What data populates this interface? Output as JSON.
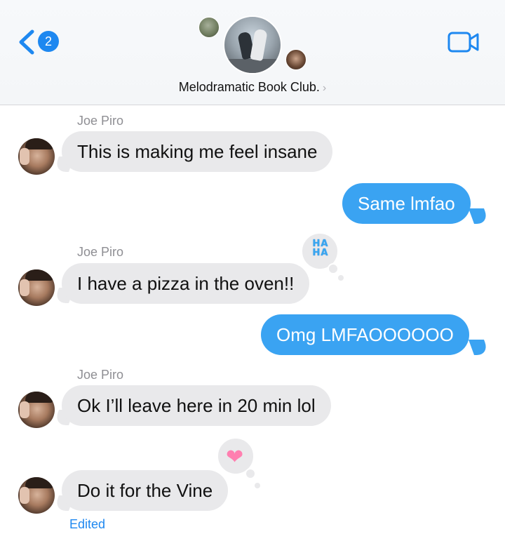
{
  "header": {
    "back_badge_count": "2",
    "group_name": "Melodramatic Book Club.",
    "chevron": "›"
  },
  "messages": [
    {
      "sender": "Joe Piro",
      "text": "This is making me feel insane",
      "direction": "incoming"
    },
    {
      "text": "Same lmfao",
      "direction": "outgoing"
    },
    {
      "sender": "Joe Piro",
      "text": "I have a pizza in the oven!!",
      "direction": "incoming",
      "tapback": "HA HA"
    },
    {
      "text": "Omg LMFAOOOOOO",
      "direction": "outgoing"
    },
    {
      "sender": "Joe Piro",
      "text": "Ok I’ll leave here in 20 min lol",
      "direction": "incoming"
    },
    {
      "text": "Do it for the Vine",
      "direction": "incoming",
      "tapback": "heart",
      "status": "Edited"
    }
  ],
  "tapbacks": {
    "haha_top": "HA",
    "haha_bottom": "HA",
    "heart_glyph": "❤"
  },
  "colors": {
    "accent": "#1e88f0",
    "outgoing_bubble": "#3aa3f2",
    "incoming_bubble": "#e9e9eb",
    "sender_gray": "#8e8e93",
    "heart_pink": "#ff7fb0"
  },
  "icons": [
    "chevron-left-icon",
    "video-camera-icon",
    "chevron-right-icon",
    "haha-tapback-icon",
    "heart-tapback-icon"
  ]
}
